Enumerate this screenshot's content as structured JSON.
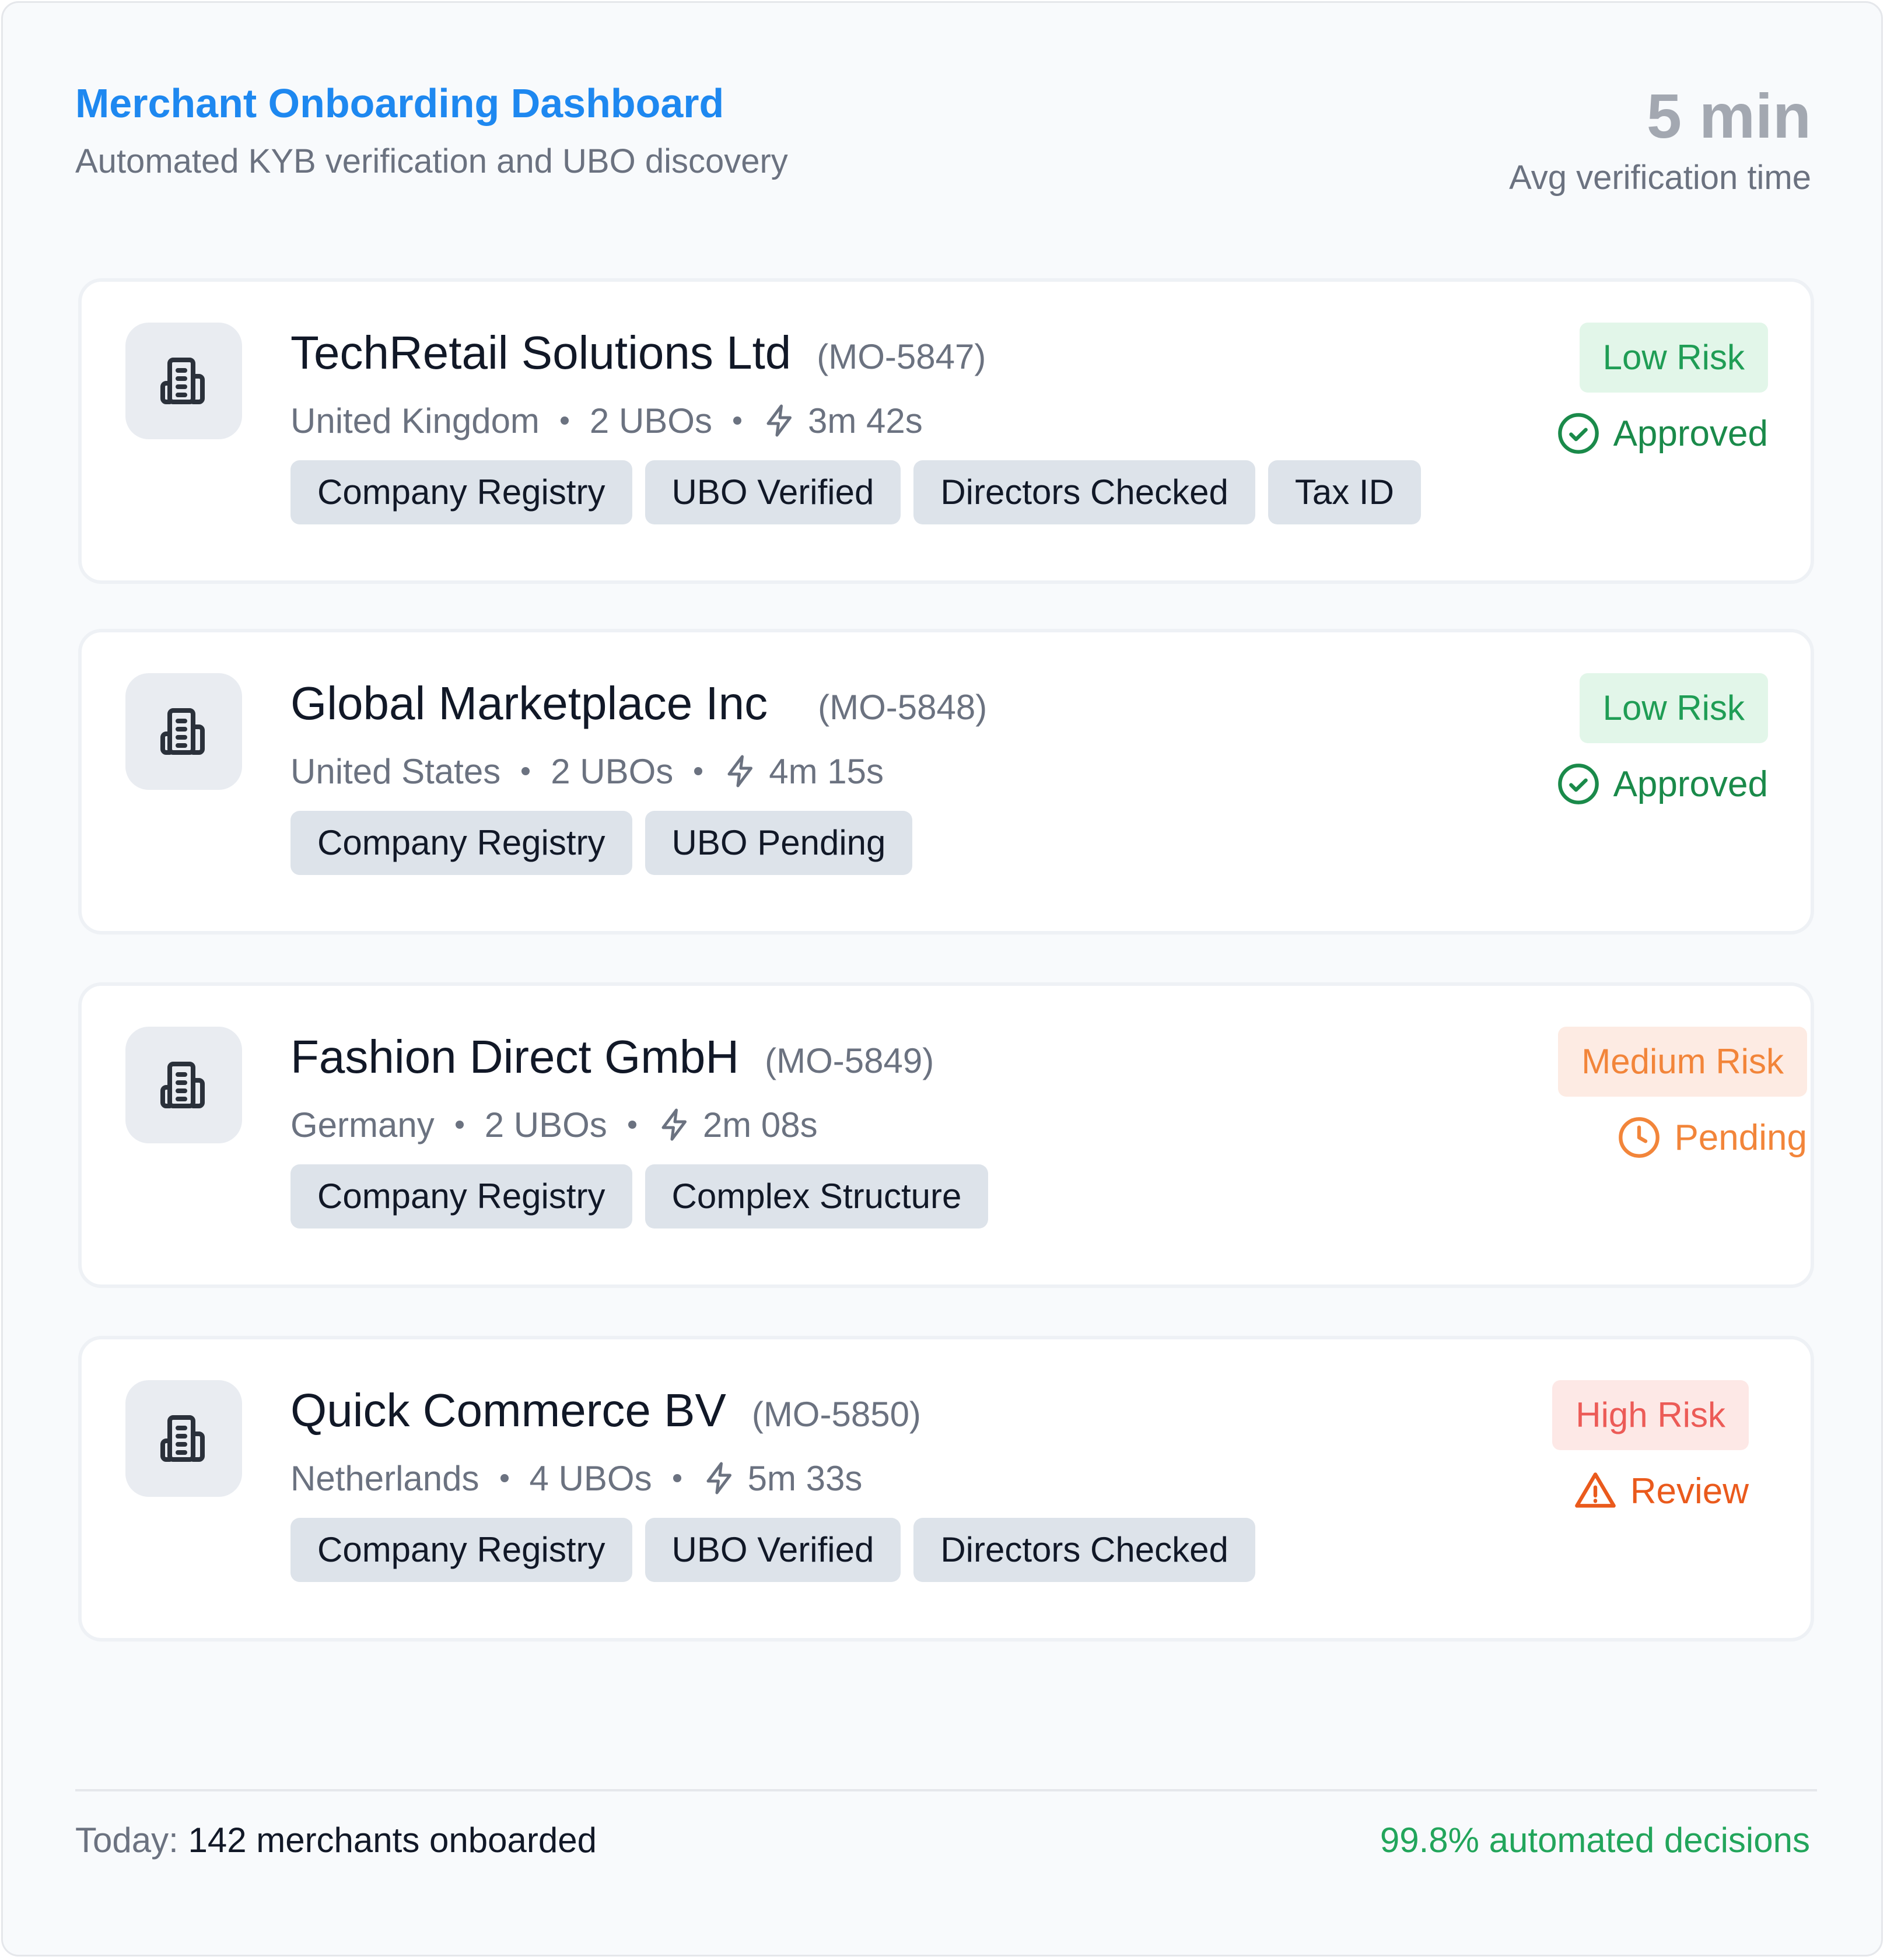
{
  "header": {
    "title": "Merchant Onboarding Dashboard",
    "subtitle": "Automated KYB verification and UBO discovery",
    "stat_value": "5 min",
    "stat_label": "Avg verification time"
  },
  "merchants": [
    {
      "name": "TechRetail Solutions Ltd",
      "id": "(MO-5847)",
      "country": "United Kingdom",
      "ubos": "2 UBOs",
      "time": "3m 42s",
      "tags": [
        "Company Registry",
        "UBO Verified",
        "Directors Checked",
        "Tax ID"
      ],
      "risk": "Low Risk",
      "status": "Approved",
      "icons": {
        "merchant": "building-icon",
        "time": "bolt-icon",
        "status": "check-circle-icon"
      }
    },
    {
      "name": "Global Marketplace Inc",
      "id": "(MO-5848)",
      "country": "United States",
      "ubos": "2 UBOs",
      "time": "4m 15s",
      "tags": [
        "Company Registry",
        "UBO Pending"
      ],
      "risk": "Low Risk",
      "status": "Approved",
      "icons": {
        "merchant": "building-icon",
        "time": "bolt-icon",
        "status": "check-circle-icon"
      }
    },
    {
      "name": "Fashion Direct GmbH",
      "id": "(MO-5849)",
      "country": "Germany",
      "ubos": "2 UBOs",
      "time": "2m 08s",
      "tags": [
        "Company Registry",
        "Complex Structure"
      ],
      "risk": "Medium Risk",
      "status": "Pending",
      "icons": {
        "merchant": "building-icon",
        "time": "bolt-icon",
        "status": "clock-icon"
      }
    },
    {
      "name": "Quick Commerce BV",
      "id": "(MO-5850)",
      "country": "Netherlands",
      "ubos": "4 UBOs",
      "time": "5m 33s",
      "tags": [
        "Company Registry",
        "UBO Verified",
        "Directors Checked"
      ],
      "risk": "High Risk",
      "status": "Review",
      "icons": {
        "merchant": "building-icon",
        "time": "bolt-icon",
        "status": "warning-triangle-icon"
      }
    }
  ],
  "footer": {
    "prefix": "Today:",
    "count_text": "142 merchants onboarded",
    "automation": "99.8% automated decisions"
  },
  "colors": {
    "accent": "#1e88f0",
    "low_risk": "#1f9d55",
    "medium_risk": "#f2853a",
    "high_risk": "#ec5b57",
    "approved": "#1a8a4a",
    "review": "#ea5a1c",
    "automation": "#22a55b"
  }
}
